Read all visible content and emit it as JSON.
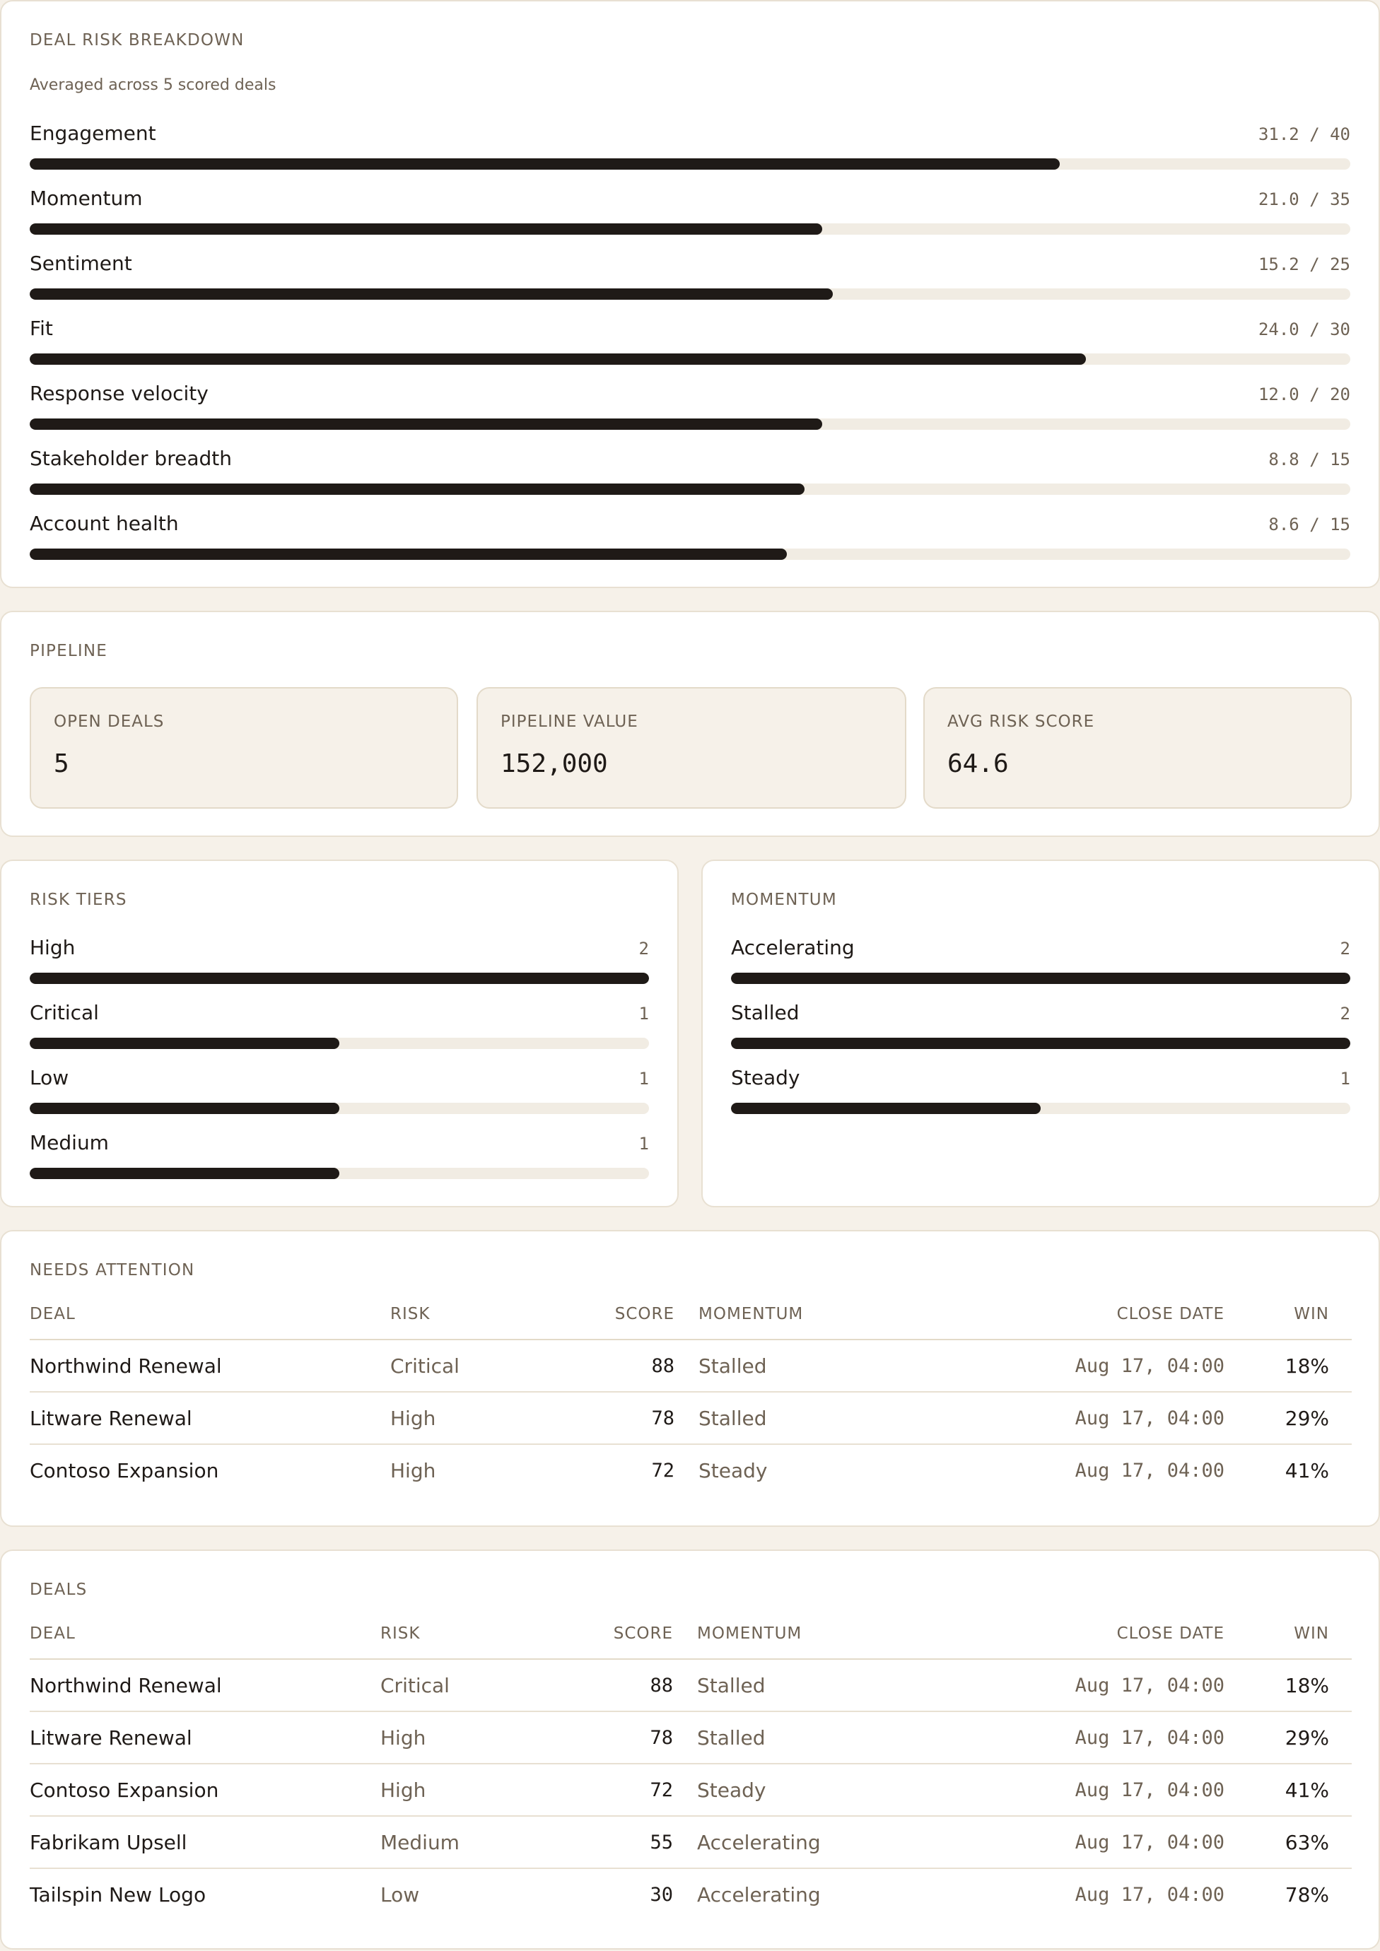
{
  "breakdown": {
    "title": "DEAL RISK BREAKDOWN",
    "subtitle": "Averaged across 5 scored deals",
    "items": [
      {
        "label": "Engagement",
        "value_text": "31.2 / 40",
        "value": 31.2,
        "max": 40
      },
      {
        "label": "Momentum",
        "value_text": "21.0 / 35",
        "value": 21.0,
        "max": 35
      },
      {
        "label": "Sentiment",
        "value_text": "15.2 / 25",
        "value": 15.2,
        "max": 25
      },
      {
        "label": "Fit",
        "value_text": "24.0 / 30",
        "value": 24.0,
        "max": 30
      },
      {
        "label": "Response velocity",
        "value_text": "12.0 / 20",
        "value": 12.0,
        "max": 20
      },
      {
        "label": "Stakeholder breadth",
        "value_text": "8.8 / 15",
        "value": 8.8,
        "max": 15
      },
      {
        "label": "Account health",
        "value_text": "8.6 / 15",
        "value": 8.6,
        "max": 15
      }
    ]
  },
  "pipeline": {
    "title": "PIPELINE",
    "stats": [
      {
        "label": "OPEN DEALS",
        "value": "5"
      },
      {
        "label": "PIPELINE VALUE",
        "value": "152,000"
      },
      {
        "label": "AVG RISK SCORE",
        "value": "64.6"
      }
    ]
  },
  "risk_tiers": {
    "title": "RISK TIERS",
    "max": 2,
    "items": [
      {
        "label": "High",
        "count": "2",
        "value": 2
      },
      {
        "label": "Critical",
        "count": "1",
        "value": 1
      },
      {
        "label": "Low",
        "count": "1",
        "value": 1
      },
      {
        "label": "Medium",
        "count": "1",
        "value": 1
      }
    ]
  },
  "momentum": {
    "title": "MOMENTUM",
    "max": 2,
    "items": [
      {
        "label": "Accelerating",
        "count": "2",
        "value": 2
      },
      {
        "label": "Stalled",
        "count": "2",
        "value": 2
      },
      {
        "label": "Steady",
        "count": "1",
        "value": 1
      }
    ]
  },
  "columns": {
    "deal": "DEAL",
    "risk": "RISK",
    "score": "SCORE",
    "momentum": "MOMENTUM",
    "close": "CLOSE DATE",
    "win": "WIN"
  },
  "needs_attention": {
    "title": "NEEDS ATTENTION",
    "rows": [
      {
        "deal": "Northwind Renewal",
        "risk": "Critical",
        "score": "88",
        "momentum": "Stalled",
        "close": "Aug 17, 04:00",
        "win": "18%"
      },
      {
        "deal": "Litware Renewal",
        "risk": "High",
        "score": "78",
        "momentum": "Stalled",
        "close": "Aug 17, 04:00",
        "win": "29%"
      },
      {
        "deal": "Contoso Expansion",
        "risk": "High",
        "score": "72",
        "momentum": "Steady",
        "close": "Aug 17, 04:00",
        "win": "41%"
      }
    ]
  },
  "deals": {
    "title": "DEALS",
    "rows": [
      {
        "deal": "Northwind Renewal",
        "risk": "Critical",
        "score": "88",
        "momentum": "Stalled",
        "close": "Aug 17, 04:00",
        "win": "18%"
      },
      {
        "deal": "Litware Renewal",
        "risk": "High",
        "score": "78",
        "momentum": "Stalled",
        "close": "Aug 17, 04:00",
        "win": "29%"
      },
      {
        "deal": "Contoso Expansion",
        "risk": "High",
        "score": "72",
        "momentum": "Steady",
        "close": "Aug 17, 04:00",
        "win": "41%"
      },
      {
        "deal": "Fabrikam Upsell",
        "risk": "Medium",
        "score": "55",
        "momentum": "Accelerating",
        "close": "Aug 17, 04:00",
        "win": "63%"
      },
      {
        "deal": "Tailspin New Logo",
        "risk": "Low",
        "score": "30",
        "momentum": "Accelerating",
        "close": "Aug 17, 04:00",
        "win": "78%"
      }
    ]
  }
}
